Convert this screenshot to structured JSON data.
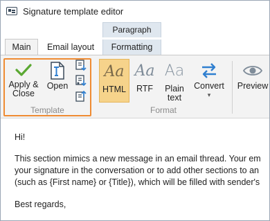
{
  "window": {
    "title": "Signature template editor",
    "icon": "signature-window-icon"
  },
  "context_tab": {
    "label": "Paragraph"
  },
  "tabs": [
    {
      "label": "Main",
      "active": true
    },
    {
      "label": "Email layout",
      "active": false
    },
    {
      "label": "Formatting",
      "active": false
    }
  ],
  "ribbon": {
    "template_group": {
      "label": "Template",
      "apply_close": {
        "line1": "Apply &",
        "line2": "Close",
        "icon": "checkmark-icon"
      },
      "open": {
        "label": "Open",
        "icon": "open-template-icon"
      }
    },
    "format_group": {
      "label": "Format",
      "html": {
        "label": "HTML",
        "glyph": "Aa",
        "selected": true
      },
      "rtf": {
        "label": "RTF",
        "glyph": "Aa"
      },
      "plain": {
        "line1": "Plain",
        "line2": "text",
        "glyph": "Aa"
      },
      "convert": {
        "label": "Convert",
        "caret": "▾",
        "icon": "convert-arrows-icon"
      }
    },
    "preview": {
      "label": "Preview",
      "icon": "eye-icon"
    }
  },
  "colors": {
    "accent_orange": "#ef8b32",
    "html_selected": "#f6d38b",
    "check_green": "#5aa832",
    "arrow_blue": "#2f7fd0"
  },
  "content": {
    "greeting": "Hi!",
    "para_line1": "This section mimics a new message in an email thread. Your em",
    "para_line2": "your signature in the conversation or to add other sections to an",
    "para_line3": "(such as {First name} or {Title}), which will be filled with sender's",
    "closing": "Best regards,"
  }
}
